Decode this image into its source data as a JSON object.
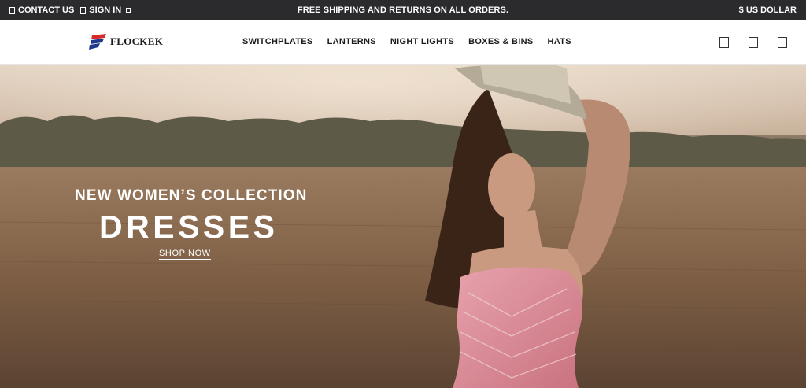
{
  "topbar": {
    "contact": "CONTACT US",
    "signin": "SIGN IN",
    "announcement": "FREE SHIPPING AND RETURNS ON ALL ORDERS.",
    "currency": "$ US DOLLAR"
  },
  "header": {
    "brand": "FLOCKEK",
    "nav": [
      "SWITCHPLATES",
      "LANTERNS",
      "NIGHT LIGHTS",
      "BOXES & BINS",
      "HATS"
    ],
    "icons": [
      "search-icon",
      "account-icon",
      "cart-icon"
    ]
  },
  "hero": {
    "subtitle": "NEW WOMEN’S COLLECTION",
    "title": "DRESSES",
    "cta": "SHOP NOW"
  },
  "colors": {
    "topbar_bg": "#2b2b2e",
    "logo_blue": "#1f3a8a",
    "logo_red": "#d62b2b"
  }
}
